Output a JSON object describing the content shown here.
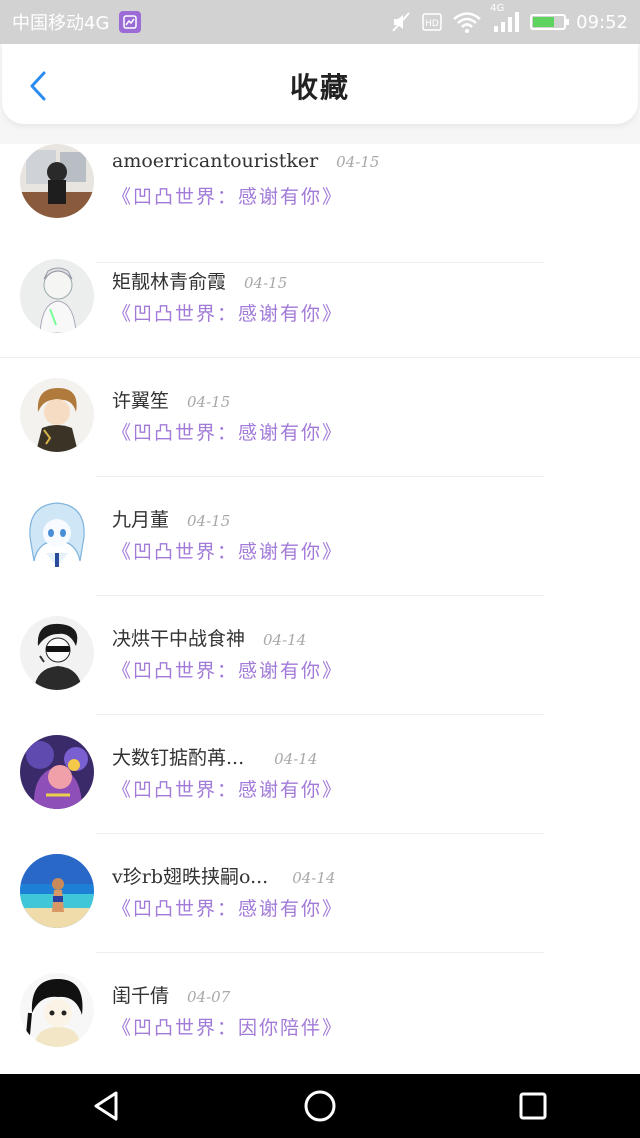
{
  "status_bar": {
    "carrier": "中国移动4G",
    "time": "09:52",
    "network": "4G",
    "hd": "HD",
    "battery_level": 0.7,
    "icons": [
      "app-notification-icon",
      "mute-icon",
      "hd-icon",
      "wifi-icon",
      "signal-icon",
      "battery-icon"
    ]
  },
  "header": {
    "title": "收藏",
    "back_icon": "chevron-left-icon",
    "accent_color": "#2a8cf0"
  },
  "colors": {
    "tag": "#a27ad8",
    "date": "#a8a8a8",
    "name": "#333333"
  },
  "items": [
    {
      "name": "amoerricantouristker",
      "date": "04-15",
      "tag": "《凹凸世界：感谢有你》",
      "avatar": "avatar-1"
    },
    {
      "name": "矩靓林青俞霞",
      "date": "04-15",
      "tag": "《凹凸世界：感谢有你》",
      "avatar": "avatar-2"
    },
    {
      "name": "许翼笙",
      "date": "04-15",
      "tag": "《凹凸世界：感谢有你》",
      "avatar": "avatar-3"
    },
    {
      "name": "九月董",
      "date": "04-15",
      "tag": "《凹凸世界：感谢有你》",
      "avatar": "avatar-4"
    },
    {
      "name": "决烘干中战食神",
      "date": "04-14",
      "tag": "《凹凸世界：感谢有你》",
      "avatar": "avatar-5"
    },
    {
      "name": "大数钉掂酌苒...",
      "date": "04-14",
      "tag": "《凹凸世界：感谢有你》",
      "avatar": "avatar-6"
    },
    {
      "name": "v珍rb翅昳挟嗣o...",
      "date": "04-14",
      "tag": "《凹凸世界：感谢有你》",
      "avatar": "avatar-7"
    },
    {
      "name": "闺千倩",
      "date": "04-07",
      "tag": "《凹凸世界：因你陪伴》",
      "avatar": "avatar-8"
    }
  ],
  "nav": [
    "back-triangle-icon",
    "home-circle-icon",
    "recents-square-icon"
  ]
}
